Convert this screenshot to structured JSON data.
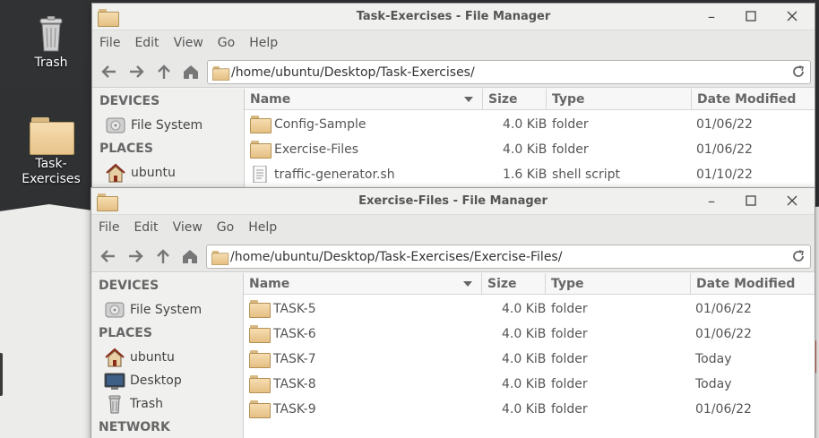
{
  "desktop": {
    "icons": [
      {
        "label": "Trash",
        "icon": "trash-icon"
      },
      {
        "label": "Task-\nExercises",
        "label_line1": "Task-",
        "label_line2": "Exercises",
        "icon": "folder-icon"
      }
    ]
  },
  "window_back": {
    "title": "Task-Exercises - File Manager",
    "menu": [
      "File",
      "Edit",
      "View",
      "Go",
      "Help"
    ],
    "path": "/home/ubuntu/Desktop/Task-Exercises/",
    "sidebar": {
      "devices_heading": "DEVICES",
      "devices": [
        {
          "label": "File System",
          "icon": "drive-icon"
        }
      ],
      "places_heading": "PLACES",
      "places": [
        {
          "label": "ubuntu",
          "icon": "home-icon"
        }
      ]
    },
    "columns": {
      "name": "Name",
      "size": "Size",
      "type": "Type",
      "date": "Date Modified"
    },
    "files": [
      {
        "name": "Config-Sample",
        "size": "4.0 KiB",
        "type": "folder",
        "date": "01/06/22",
        "icon": "folder-icon"
      },
      {
        "name": "Exercise-Files",
        "size": "4.0 KiB",
        "type": "folder",
        "date": "01/06/22",
        "icon": "folder-icon"
      },
      {
        "name": "traffic-generator.sh",
        "size": "1.6 KiB",
        "type": "shell script",
        "date": "01/10/22",
        "icon": "script-file-icon"
      }
    ]
  },
  "window_front": {
    "title": "Exercise-Files - File Manager",
    "menu": [
      "File",
      "Edit",
      "View",
      "Go",
      "Help"
    ],
    "path": "/home/ubuntu/Desktop/Task-Exercises/Exercise-Files/",
    "sidebar": {
      "devices_heading": "DEVICES",
      "devices": [
        {
          "label": "File System",
          "icon": "drive-icon"
        }
      ],
      "places_heading": "PLACES",
      "places": [
        {
          "label": "ubuntu",
          "icon": "home-icon"
        },
        {
          "label": "Desktop",
          "icon": "desktop-icon"
        },
        {
          "label": "Trash",
          "icon": "trash-icon"
        }
      ],
      "network_heading": "NETWORK"
    },
    "columns": {
      "name": "Name",
      "size": "Size",
      "type": "Type",
      "date": "Date Modified"
    },
    "files": [
      {
        "name": "TASK-5",
        "size": "4.0 KiB",
        "type": "folder",
        "date": "01/06/22",
        "icon": "folder-icon"
      },
      {
        "name": "TASK-6",
        "size": "4.0 KiB",
        "type": "folder",
        "date": "01/06/22",
        "icon": "folder-icon"
      },
      {
        "name": "TASK-7",
        "size": "4.0 KiB",
        "type": "folder",
        "date": "Today",
        "icon": "folder-icon"
      },
      {
        "name": "TASK-8",
        "size": "4.0 KiB",
        "type": "folder",
        "date": "Today",
        "icon": "folder-icon"
      },
      {
        "name": "TASK-9",
        "size": "4.0 KiB",
        "type": "folder",
        "date": "01/06/22",
        "icon": "folder-icon"
      }
    ]
  },
  "colors": {
    "desktop_bg": "#2f3134",
    "folder": "#f0d3a0",
    "titlebar": "#f0f0ef",
    "toolbar": "#e8e8e7"
  }
}
